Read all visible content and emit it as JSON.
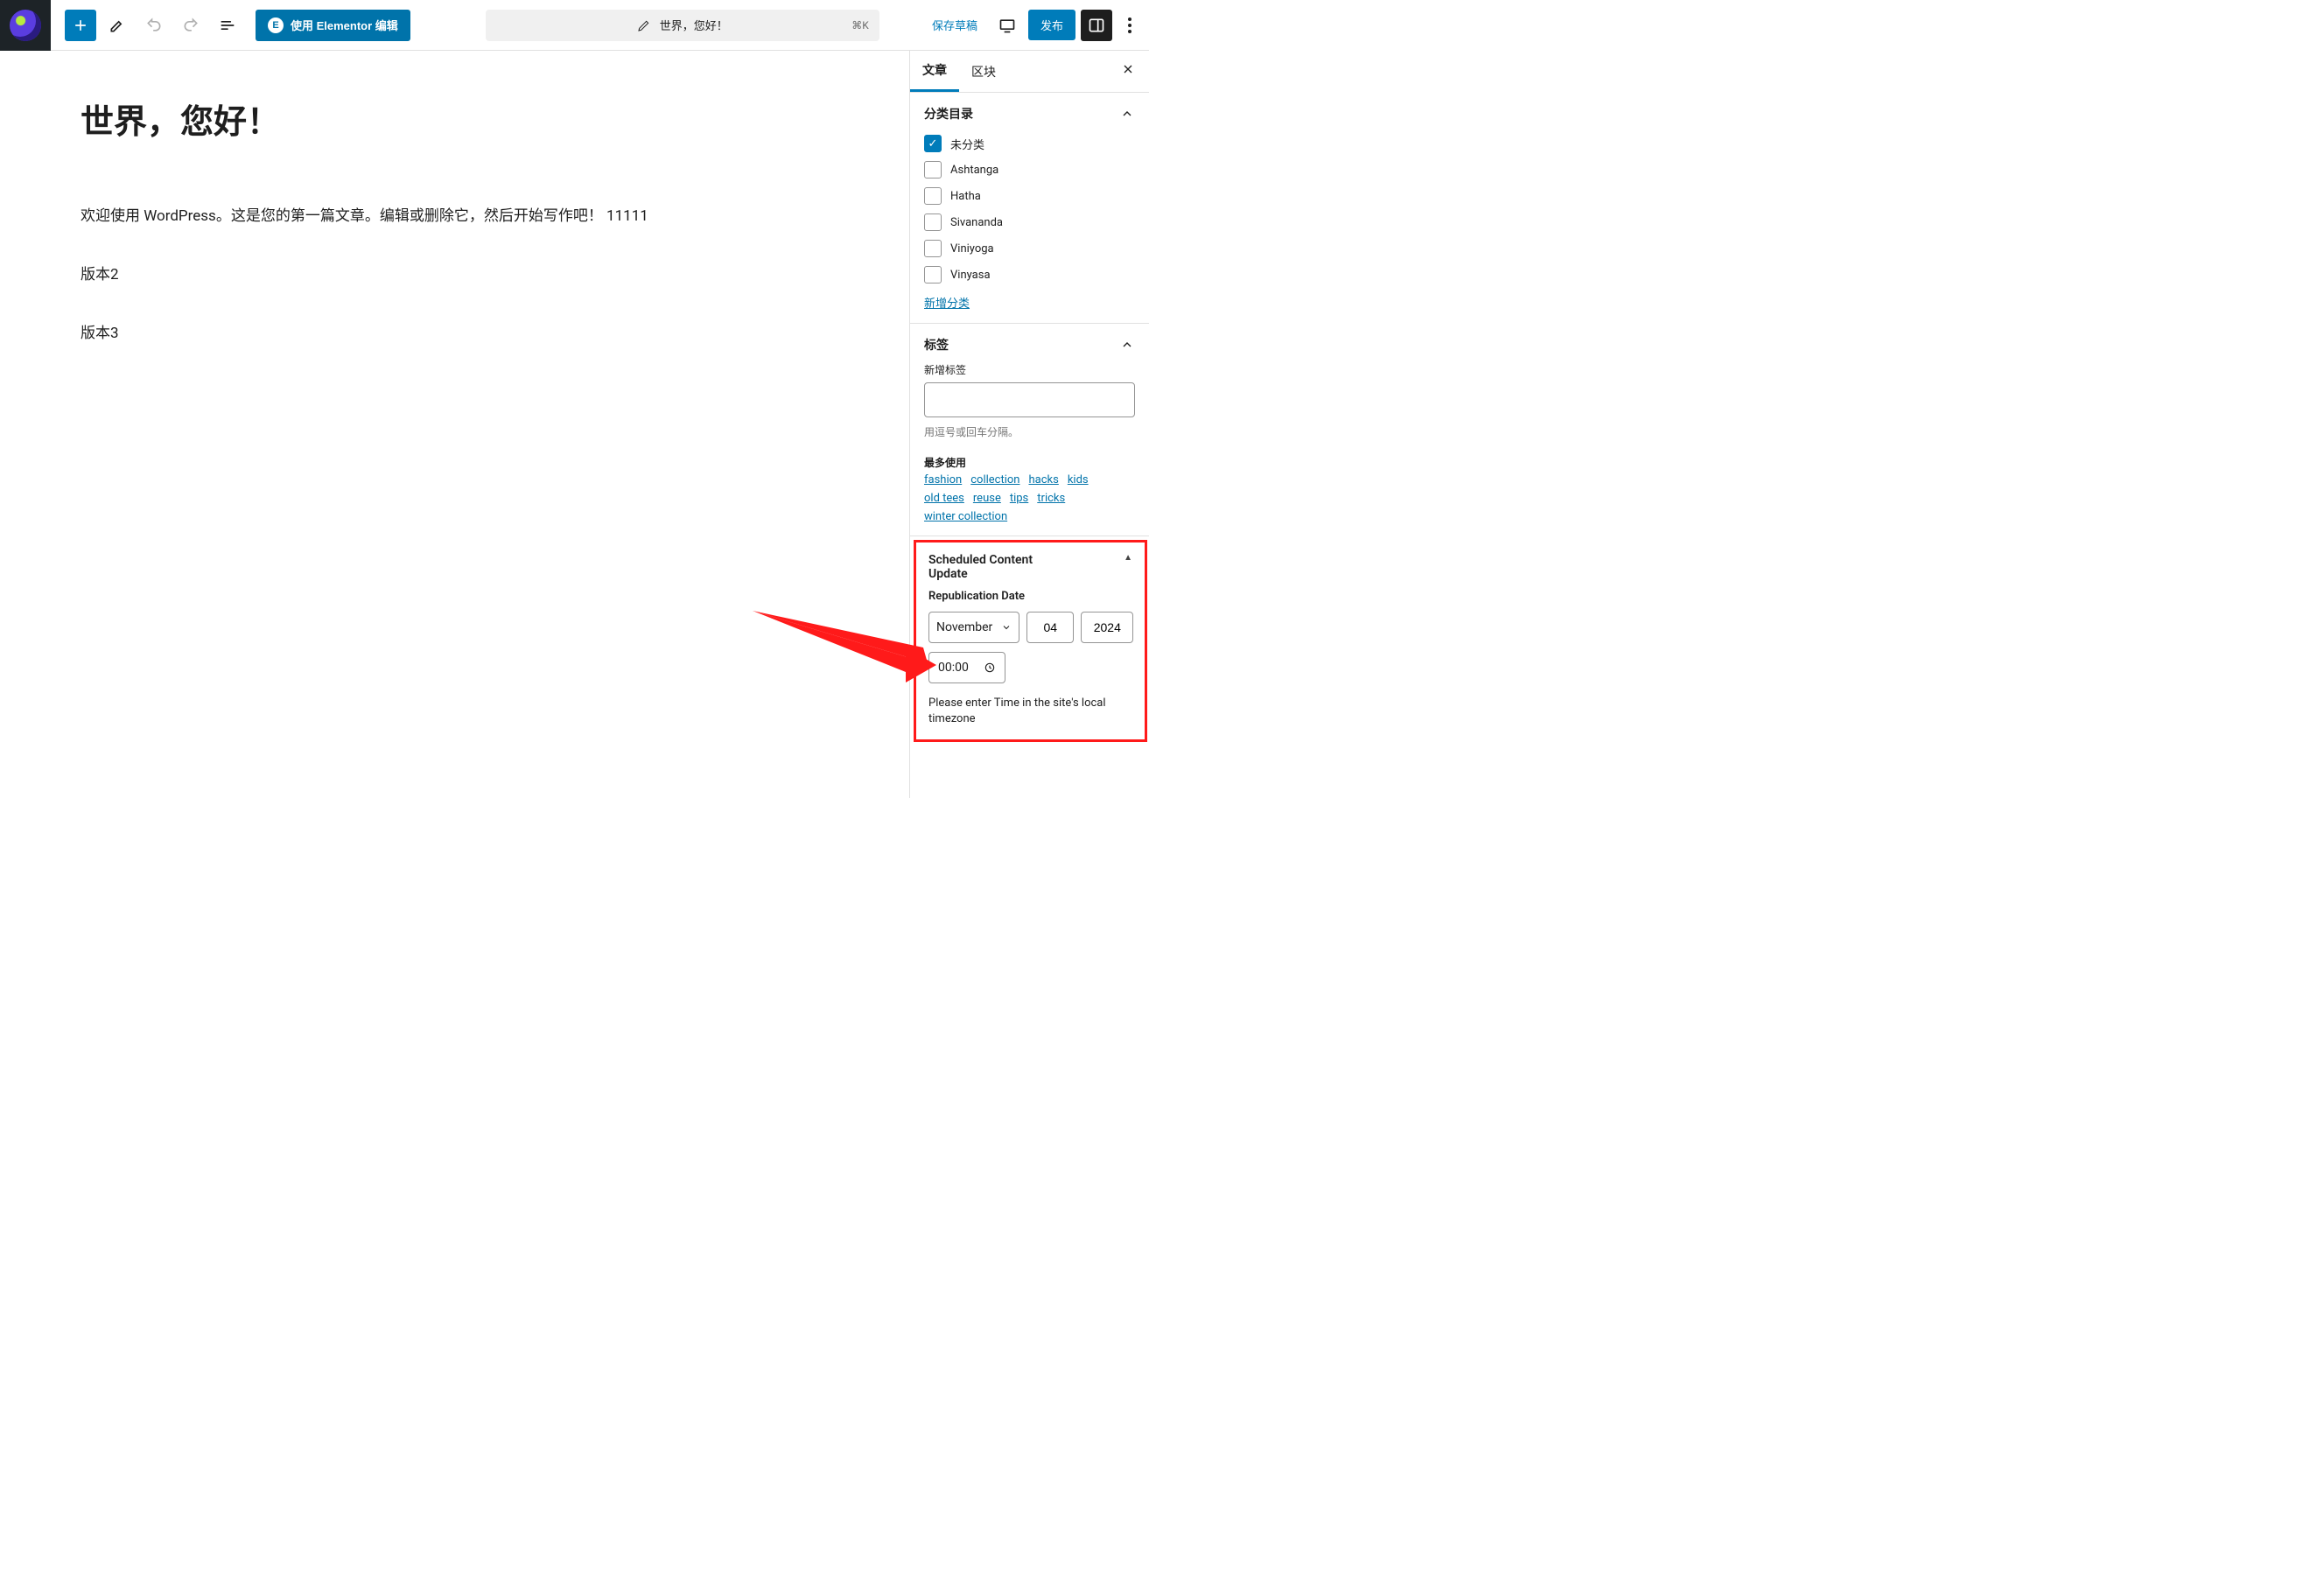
{
  "toolbar": {
    "elementor_label": "使用 Elementor 编辑",
    "title_bar": "世界，您好！",
    "shortcut": "⌘K",
    "save_draft": "保存草稿",
    "publish": "发布"
  },
  "tabs": {
    "post": "文章",
    "block": "区块"
  },
  "post": {
    "title": "世界，您好！",
    "p1": "欢迎使用 WordPress。这是您的第一篇文章。编辑或删除它，然后开始写作吧！ 11111",
    "p2": "版本2",
    "p3": "版本3"
  },
  "categories": {
    "heading": "分类目录",
    "items": [
      {
        "label": "未分类",
        "checked": true
      },
      {
        "label": "Ashtanga",
        "checked": false
      },
      {
        "label": "Hatha",
        "checked": false
      },
      {
        "label": "Sivananda",
        "checked": false
      },
      {
        "label": "Viniyoga",
        "checked": false
      },
      {
        "label": "Vinyasa",
        "checked": false
      }
    ],
    "add_new": "新增分类"
  },
  "tags": {
    "heading": "标签",
    "new_label": "新增标签",
    "hint": "用逗号或回车分隔。",
    "most_used_heading": "最多使用",
    "cloud": [
      "fashion",
      "collection",
      "hacks",
      "kids",
      "old tees",
      "reuse",
      "tips",
      "tricks",
      "winter collection"
    ]
  },
  "scheduled": {
    "heading": "Scheduled Content Update",
    "sub": "Republication Date",
    "month": "November",
    "day": "04",
    "year": "2024",
    "time": "00:00",
    "note": "Please enter Time in the site's local timezone"
  }
}
